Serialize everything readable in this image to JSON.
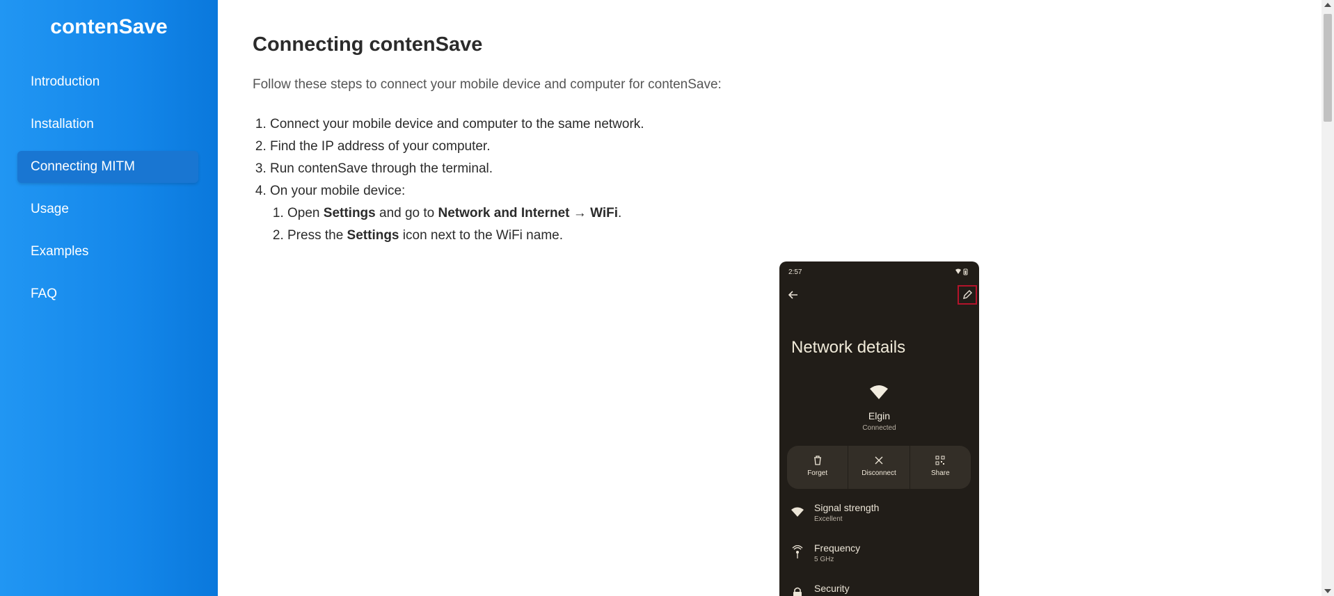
{
  "sidebar": {
    "brand": "contenSave",
    "items": [
      {
        "label": "Introduction"
      },
      {
        "label": "Installation"
      },
      {
        "label": "Connecting MITM"
      },
      {
        "label": "Usage"
      },
      {
        "label": "Examples"
      },
      {
        "label": "FAQ"
      }
    ],
    "active_index": 2,
    "gradient_start": "#2196f3",
    "gradient_end": "#0a78dc",
    "active_color": "#1976d2"
  },
  "main": {
    "title": "Connecting contenSave",
    "intro": "Follow these steps to connect your mobile device and computer for contenSave:",
    "steps": [
      "Connect your mobile device and computer to the same network.",
      "Find the IP address of your computer.",
      "Run contenSave through the terminal.",
      "On your mobile device:"
    ],
    "substeps": {
      "s1": {
        "a": "Open ",
        "b1": "Settings",
        "c": " and go to ",
        "b2": "Network and Internet",
        "d": " → ",
        "b3": "WiFi",
        "e": "."
      },
      "s2": {
        "a": "Press the ",
        "b1": "Settings",
        "c": " icon next to the WiFi name."
      }
    }
  },
  "phone": {
    "time": "2:57",
    "title": "Network details",
    "ssid": "Elgin",
    "status": "Connected",
    "actions": [
      {
        "label": "Forget",
        "icon": "trash-icon"
      },
      {
        "label": "Disconnect",
        "icon": "close-icon"
      },
      {
        "label": "Share",
        "icon": "qr-code-icon"
      }
    ],
    "rows": [
      {
        "title": "Signal strength",
        "value": "Excellent",
        "icon": "wifi-icon"
      },
      {
        "title": "Frequency",
        "value": "5 GHz",
        "icon": "antenna-icon"
      },
      {
        "title": "Security",
        "value": "",
        "icon": "lock-icon"
      }
    ],
    "bg_color": "#211d18",
    "highlight_color": "#b3132b"
  }
}
